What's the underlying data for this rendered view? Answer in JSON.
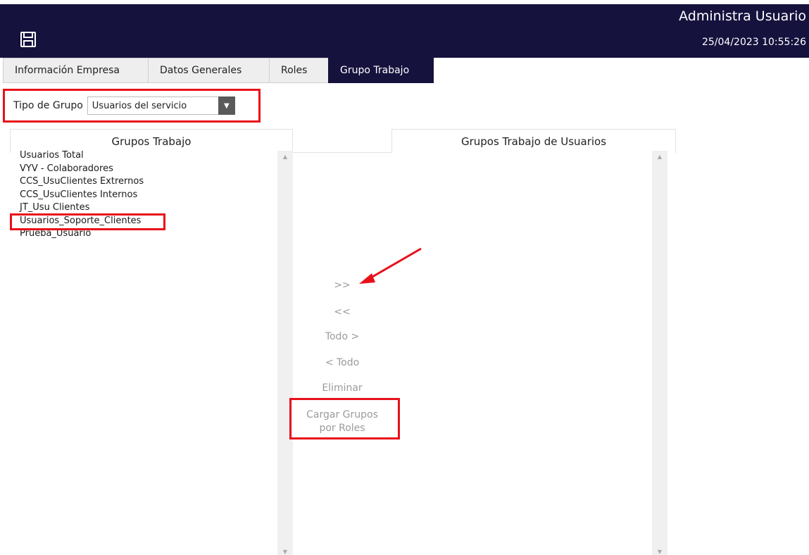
{
  "header": {
    "title": "Administra Usuario",
    "datetime": "25/04/2023 10:55:26",
    "save_icon": "floppy-disk-icon"
  },
  "tabs": [
    {
      "label": "Información Empresa",
      "active": false
    },
    {
      "label": "Datos Generales",
      "active": false
    },
    {
      "label": "Roles",
      "active": false
    },
    {
      "label": "Grupo Trabajo",
      "active": true
    }
  ],
  "tipo_grupo": {
    "label": "Tipo de Grupo",
    "selected": "Usuarios del servicio"
  },
  "left_panel": {
    "header": "Grupos Trabajo",
    "items": [
      "Usuarios Total",
      "VYV - Colaboradores",
      "CCS_UsuClientes Extrernos",
      "CCS_UsuClientes Internos",
      "JT_Usu Clientes",
      "Usuarios_Soporte_Clientes",
      "Prueba_Usuario"
    ]
  },
  "right_panel": {
    "header": "Grupos Trabajo de Usuarios",
    "items": []
  },
  "controls": {
    "move_right": ">>",
    "move_left": "<<",
    "all_right": "Todo >",
    "all_left": "< Todo",
    "delete": "Eliminar",
    "load_line1": "Cargar Grupos",
    "load_line2": "por Roles"
  },
  "colors": {
    "header_bg": "#16123e",
    "highlight": "#e8111a",
    "disabled_text": "#9b9b9b"
  }
}
